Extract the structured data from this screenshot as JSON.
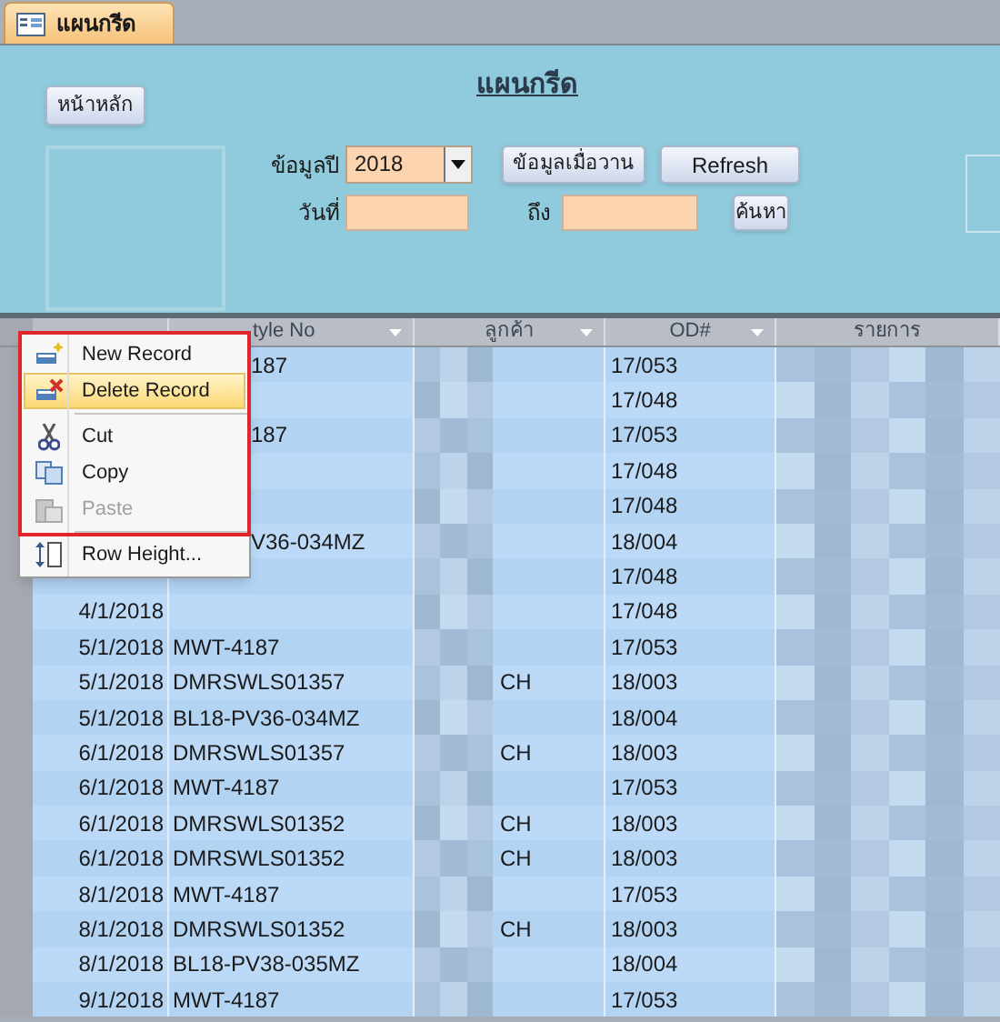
{
  "document_tab": {
    "label": "แผนกรีด",
    "selected": true
  },
  "form": {
    "title": "แผนกรีด",
    "home_button": "หน้าหลัก",
    "year_label": "ข้อมูลปี",
    "year_value": "2018",
    "yesterday_button": "ข้อมูลเมื่อวาน",
    "refresh_button": "Refresh",
    "date_label": "วันที่",
    "to_label": "ถึง",
    "search_button": "ค้นหา"
  },
  "table": {
    "columns": [
      {
        "filter": false
      },
      {
        "label": "tyle No",
        "filter": true
      },
      {
        "label": "ลูกค้า",
        "filter": true
      },
      {
        "label": "OD#",
        "filter": true
      },
      {
        "label": "รายการ",
        "filter": false
      }
    ],
    "rows": [
      {
        "style_no": "187",
        "od": "17/053"
      },
      {
        "od": "17/048"
      },
      {
        "style_no": "187",
        "od": "17/053"
      },
      {
        "od": "17/048"
      },
      {
        "od": "17/048"
      },
      {
        "style_no": "V36-034MZ",
        "od": "18/004"
      },
      {
        "od": "17/048"
      },
      {
        "date": "4/1/2018",
        "od": "17/048"
      },
      {
        "date": "5/1/2018",
        "style_no": "MWT-4187",
        "od": "17/053"
      },
      {
        "date": "5/1/2018",
        "style_no": "DMRSWLS01357",
        "customer": "CH",
        "od": "18/003"
      },
      {
        "date": "5/1/2018",
        "style_no": "BL18-PV36-034MZ",
        "od": "18/004"
      },
      {
        "date": "6/1/2018",
        "style_no": "DMRSWLS01357",
        "customer": "CH",
        "od": "18/003"
      },
      {
        "date": "6/1/2018",
        "style_no": "MWT-4187",
        "od": "17/053"
      },
      {
        "date": "6/1/2018",
        "style_no": "DMRSWLS01352",
        "customer": "CH",
        "od": "18/003"
      },
      {
        "date": "6/1/2018",
        "style_no": "DMRSWLS01352",
        "customer": "CH",
        "od": "18/003"
      },
      {
        "date": "8/1/2018",
        "style_no": "MWT-4187",
        "od": "17/053"
      },
      {
        "date": "8/1/2018",
        "style_no": "DMRSWLS01352",
        "customer": "CH",
        "od": "18/003"
      },
      {
        "date": "8/1/2018",
        "style_no": "BL18-PV38-035MZ",
        "od": "18/004"
      },
      {
        "date": "9/1/2018",
        "style_no": "MWT-4187",
        "od": "17/053"
      }
    ]
  },
  "context_menu": {
    "groups": [
      [
        {
          "label": "New Record",
          "kind": "new",
          "selected": false,
          "disabled": false
        },
        {
          "label": "Delete Record",
          "kind": "delete",
          "selected": true,
          "disabled": false
        }
      ],
      [
        {
          "label": "Cut",
          "kind": "cut",
          "selected": false,
          "disabled": false
        },
        {
          "label": "Copy",
          "kind": "copy",
          "selected": false,
          "disabled": false
        },
        {
          "label": "Paste",
          "kind": "paste",
          "selected": false,
          "disabled": true
        }
      ],
      [
        {
          "label": "Row Height...",
          "kind": "rowheight",
          "selected": false,
          "disabled": false
        }
      ]
    ]
  }
}
